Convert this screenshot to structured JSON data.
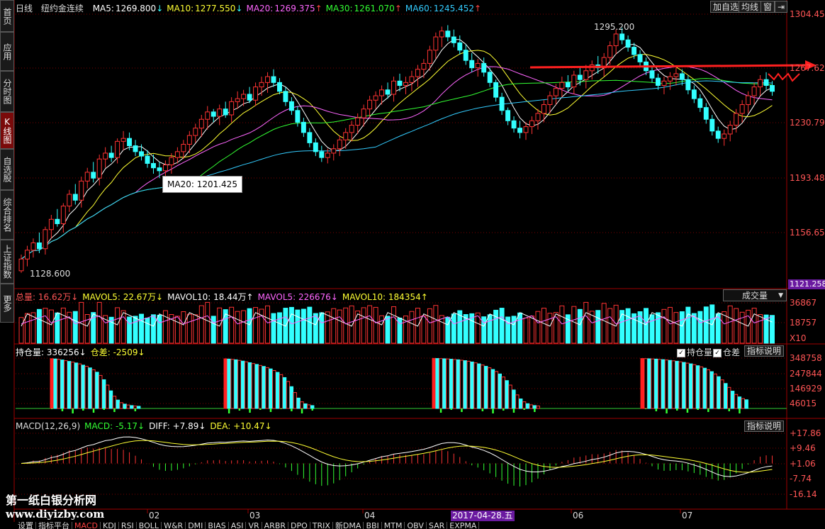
{
  "sidebar": {
    "items": [
      {
        "label": "首页",
        "active": false
      },
      {
        "label": "应用",
        "active": false
      },
      {
        "label": "分时图",
        "active": false
      },
      {
        "label": "K线图",
        "active": true
      },
      {
        "label": "自选股",
        "active": false
      },
      {
        "label": "综合排名",
        "active": false
      },
      {
        "label": "上证指数",
        "active": false
      },
      {
        "label": "更多",
        "active": false
      }
    ]
  },
  "toolbar": {
    "add_watch": "加自选",
    "ma_line": "均线",
    "window": "窗"
  },
  "header": {
    "period": "日线",
    "instrument": "纽约金连续",
    "ma": [
      {
        "label": "MA5:",
        "value": "1269.800",
        "arrow": "↓",
        "color": "#ffffff"
      },
      {
        "label": "MA10:",
        "value": "1277.550",
        "arrow": "↓",
        "color": "#ffff33"
      },
      {
        "label": "MA20:",
        "value": "1269.375",
        "arrow": "↑",
        "color": "#ff66ff"
      },
      {
        "label": "MA30:",
        "value": "1261.070",
        "arrow": "↑",
        "color": "#33ff33"
      },
      {
        "label": "MA60:",
        "value": "1245.452",
        "arrow": "↑",
        "color": "#33ccff"
      }
    ]
  },
  "price_panel": {
    "high_label": "1295.200",
    "low_label": "1128.600",
    "tooltip": "MA20: 1201.425",
    "y_ticks": [
      "1304.456",
      "1267.625",
      "1230.794",
      "1193.485",
      "1156.654",
      "1121.258"
    ],
    "current_price": "1121.258"
  },
  "volume_panel": {
    "header": [
      {
        "text": "总量: 16.62万↓",
        "color": "#ff5555"
      },
      {
        "text": "MAVOL5: 22.67万↓",
        "color": "#ffff33"
      },
      {
        "text": "MAVOL10: 18.44万↑",
        "color": "#ffffff"
      },
      {
        "text": "MAVOL5: 226676↓",
        "color": "#ff66ff"
      },
      {
        "text": "MAVOL10: 184354↑",
        "color": "#ffff33"
      }
    ],
    "dropdown": "成交量",
    "y_ticks": [
      "36867",
      "18757",
      "X10"
    ]
  },
  "oi_panel": {
    "header": [
      {
        "text": "持仓量: 336256↓",
        "color": "#ffffff"
      },
      {
        "text": "仓差: -2509↓",
        "color": "#ffff33"
      }
    ],
    "chk_oi": "持仓量",
    "chk_diff": "仓差",
    "explain": "指标说明",
    "y_ticks": [
      "348758",
      "247844",
      "146929",
      "46015"
    ]
  },
  "macd_panel": {
    "header": [
      {
        "text": "MACD(12,26,9)",
        "color": "#dddddd"
      },
      {
        "text": "MACD: -5.17↓",
        "color": "#33ff33"
      },
      {
        "text": "DIFF: +7.89↓",
        "color": "#ffffff"
      },
      {
        "text": "DEA: +10.47↓",
        "color": "#ffff33"
      }
    ],
    "explain": "指标说明",
    "y_ticks": [
      "+17.86",
      "+9.46",
      "+1.06",
      "-7.74",
      "-16.14"
    ]
  },
  "x_axis": {
    "months": [
      "02",
      "03",
      "04",
      "06",
      "07"
    ],
    "cursor_date": "2017-04-28.五"
  },
  "watermark": {
    "line1": "第一纸白银分析网",
    "line2": "www.diyizby.com"
  },
  "bottom_tabs": [
    "设置",
    "指标平台",
    "MACD",
    "KDJ",
    "RSI",
    "BOLL",
    "W&R",
    "DMI",
    "BIAS",
    "ASI",
    "VR",
    "ARBR",
    "DPO",
    "TRIX",
    "新DMA",
    "BBI",
    "MTM",
    "OBV",
    "SAR",
    "EXPMA"
  ],
  "active_bottom_tab": "MACD",
  "colors": {
    "up": "#ff3333",
    "down": "#33ffff",
    "ma5": "#ffffff",
    "ma10": "#ffff33",
    "ma20": "#ff66ff",
    "ma30": "#33ff33",
    "ma60": "#33ccff",
    "trend": "#ff2020",
    "grid": "#7a0000"
  },
  "chart_data": {
    "type": "candlestick",
    "instrument": "纽约金连续",
    "period": "日线",
    "ylim": [
      1121.258,
      1304.456
    ],
    "candles": [
      [
        1130,
        1128.6,
        1141,
        1138
      ],
      [
        1138,
        1133,
        1147,
        1144
      ],
      [
        1144,
        1139,
        1152,
        1149
      ],
      [
        1149,
        1142,
        1156,
        1145
      ],
      [
        1145,
        1141,
        1160,
        1158
      ],
      [
        1158,
        1152,
        1168,
        1165
      ],
      [
        1165,
        1160,
        1172,
        1162
      ],
      [
        1162,
        1156,
        1176,
        1174
      ],
      [
        1174,
        1170,
        1185,
        1182
      ],
      [
        1182,
        1175,
        1189,
        1178
      ],
      [
        1178,
        1173,
        1194,
        1191
      ],
      [
        1191,
        1186,
        1200,
        1197
      ],
      [
        1197,
        1190,
        1204,
        1193
      ],
      [
        1193,
        1188,
        1209,
        1206
      ],
      [
        1206,
        1200,
        1214,
        1210
      ],
      [
        1210,
        1204,
        1215,
        1207
      ],
      [
        1207,
        1203,
        1220,
        1218
      ],
      [
        1218,
        1212,
        1225,
        1220
      ],
      [
        1220,
        1212,
        1224,
        1215
      ],
      [
        1215,
        1208,
        1219,
        1211
      ],
      [
        1211,
        1205,
        1216,
        1208
      ],
      [
        1208,
        1200,
        1212,
        1203
      ],
      [
        1203,
        1196,
        1209,
        1200
      ],
      [
        1200,
        1193,
        1204,
        1198
      ],
      [
        1198,
        1192,
        1205,
        1202
      ],
      [
        1202,
        1196,
        1210,
        1207
      ],
      [
        1207,
        1203,
        1214,
        1211
      ],
      [
        1211,
        1206,
        1219,
        1216
      ],
      [
        1216,
        1210,
        1225,
        1222
      ],
      [
        1222,
        1217,
        1230,
        1227
      ],
      [
        1227,
        1221,
        1236,
        1233
      ],
      [
        1233,
        1226,
        1242,
        1238
      ],
      [
        1238,
        1231,
        1240,
        1235
      ],
      [
        1235,
        1229,
        1243,
        1240
      ],
      [
        1240,
        1234,
        1245,
        1236
      ],
      [
        1236,
        1231,
        1248,
        1245
      ],
      [
        1245,
        1240,
        1252,
        1247
      ],
      [
        1247,
        1242,
        1253,
        1250
      ],
      [
        1250,
        1244,
        1255,
        1246
      ],
      [
        1246,
        1242,
        1258,
        1255
      ],
      [
        1255,
        1249,
        1262,
        1258
      ],
      [
        1258,
        1251,
        1265,
        1262
      ],
      [
        1262,
        1255,
        1267,
        1258
      ],
      [
        1258,
        1250,
        1261,
        1252
      ],
      [
        1252,
        1242,
        1255,
        1245
      ],
      [
        1245,
        1236,
        1248,
        1239
      ],
      [
        1239,
        1228,
        1242,
        1231
      ],
      [
        1231,
        1221,
        1234,
        1224
      ],
      [
        1224,
        1214,
        1227,
        1217
      ],
      [
        1217,
        1208,
        1220,
        1211
      ],
      [
        1211,
        1204,
        1215,
        1207
      ],
      [
        1207,
        1203,
        1213,
        1210
      ],
      [
        1210,
        1205,
        1216,
        1213
      ],
      [
        1213,
        1208,
        1222,
        1219
      ],
      [
        1219,
        1213,
        1227,
        1224
      ],
      [
        1224,
        1218,
        1232,
        1229
      ],
      [
        1229,
        1223,
        1237,
        1234
      ],
      [
        1234,
        1228,
        1243,
        1240
      ],
      [
        1240,
        1234,
        1249,
        1246
      ],
      [
        1246,
        1240,
        1252,
        1249
      ],
      [
        1249,
        1243,
        1256,
        1253
      ],
      [
        1253,
        1247,
        1258,
        1250
      ],
      [
        1250,
        1245,
        1262,
        1259
      ],
      [
        1259,
        1252,
        1264,
        1256
      ],
      [
        1256,
        1250,
        1262,
        1258
      ],
      [
        1258,
        1252,
        1266,
        1262
      ],
      [
        1262,
        1255,
        1270,
        1267
      ],
      [
        1267,
        1261,
        1274,
        1271
      ],
      [
        1271,
        1266,
        1283,
        1280
      ],
      [
        1280,
        1274,
        1292,
        1289
      ],
      [
        1289,
        1282,
        1296,
        1293
      ],
      [
        1293,
        1286,
        1297,
        1289
      ],
      [
        1289,
        1282,
        1294,
        1285
      ],
      [
        1285,
        1277,
        1290,
        1280
      ],
      [
        1280,
        1270,
        1284,
        1273
      ],
      [
        1273,
        1265,
        1278,
        1268
      ],
      [
        1268,
        1262,
        1274,
        1271
      ],
      [
        1271,
        1262,
        1275,
        1265
      ],
      [
        1265,
        1255,
        1268,
        1258
      ],
      [
        1258,
        1245,
        1260,
        1248
      ],
      [
        1248,
        1236,
        1251,
        1239
      ],
      [
        1239,
        1229,
        1241,
        1232
      ],
      [
        1232,
        1224,
        1235,
        1227
      ],
      [
        1227,
        1220,
        1232,
        1224
      ],
      [
        1224,
        1219,
        1231,
        1228
      ],
      [
        1228,
        1223,
        1235,
        1232
      ],
      [
        1232,
        1226,
        1240,
        1237
      ],
      [
        1237,
        1231,
        1246,
        1243
      ],
      [
        1243,
        1237,
        1252,
        1249
      ],
      [
        1249,
        1243,
        1257,
        1254
      ],
      [
        1254,
        1248,
        1262,
        1258
      ],
      [
        1258,
        1252,
        1263,
        1255
      ],
      [
        1255,
        1250,
        1266,
        1263
      ],
      [
        1263,
        1256,
        1268,
        1260
      ],
      [
        1260,
        1254,
        1270,
        1266
      ],
      [
        1266,
        1260,
        1273,
        1270
      ],
      [
        1270,
        1264,
        1276,
        1268
      ],
      [
        1268,
        1262,
        1278,
        1275
      ],
      [
        1275,
        1270,
        1286,
        1283
      ],
      [
        1283,
        1277,
        1294,
        1291
      ],
      [
        1291,
        1284,
        1295.2,
        1287
      ],
      [
        1287,
        1279,
        1290,
        1282
      ],
      [
        1282,
        1274,
        1285,
        1277
      ],
      [
        1277,
        1269,
        1280,
        1272
      ],
      [
        1272,
        1263,
        1275,
        1266
      ],
      [
        1266,
        1258,
        1269,
        1261
      ],
      [
        1261,
        1253,
        1264,
        1256
      ],
      [
        1256,
        1250,
        1262,
        1259
      ],
      [
        1259,
        1253,
        1265,
        1262
      ],
      [
        1262,
        1256,
        1268,
        1264
      ],
      [
        1264,
        1256,
        1267,
        1260
      ],
      [
        1260,
        1250,
        1263,
        1253
      ],
      [
        1253,
        1244,
        1256,
        1247
      ],
      [
        1247,
        1238,
        1250,
        1241
      ],
      [
        1241,
        1230,
        1244,
        1233
      ],
      [
        1233,
        1222,
        1236,
        1225
      ],
      [
        1225,
        1217,
        1228,
        1220
      ],
      [
        1220,
        1215,
        1226,
        1223
      ],
      [
        1223,
        1218,
        1232,
        1229
      ],
      [
        1229,
        1224,
        1240,
        1237
      ],
      [
        1237,
        1231,
        1246,
        1243
      ],
      [
        1243,
        1237,
        1252,
        1249
      ],
      [
        1249,
        1243,
        1258,
        1255
      ],
      [
        1255,
        1249,
        1263,
        1260
      ],
      [
        1260,
        1253,
        1265,
        1256
      ],
      [
        1256,
        1249,
        1259,
        1252
      ]
    ],
    "oi": {
      "x": [
        20,
        22,
        24,
        26,
        28,
        30,
        32,
        34,
        36,
        38,
        40,
        42,
        44,
        46,
        48,
        50,
        52,
        54,
        56,
        58,
        60,
        62,
        64,
        66,
        68,
        70,
        120,
        122,
        124,
        126,
        128,
        130,
        132,
        134,
        136,
        138,
        140,
        142,
        144,
        146,
        148,
        150,
        152,
        154,
        156,
        158,
        160,
        162,
        164,
        166,
        168,
        170,
        240,
        242,
        244,
        246,
        248,
        250,
        252,
        254,
        256,
        258,
        260,
        262,
        264,
        266,
        268,
        270,
        272,
        274,
        276,
        278,
        280,
        282,
        284,
        286,
        288,
        290,
        292,
        294,
        296,
        298,
        300,
        360,
        362,
        364,
        366,
        368,
        370,
        372,
        374,
        376,
        378,
        380,
        382,
        384,
        386,
        388,
        390,
        392,
        394,
        396,
        398,
        400,
        402,
        404,
        406,
        408,
        410,
        412,
        414,
        416,
        418,
        420
      ],
      "values": [
        345000,
        343000,
        340000,
        336000,
        331000,
        326000,
        321000,
        315000,
        309000,
        300000,
        292000,
        281000,
        268000,
        251000,
        229000,
        199000,
        162000,
        122000,
        85000,
        58000,
        40000,
        30000,
        24000,
        20000,
        17000,
        15000,
        344000,
        342000,
        340000,
        337000,
        333000,
        328000,
        323000,
        317000,
        311000,
        305000,
        298000,
        291000,
        283000,
        274000,
        263000,
        250000,
        234000,
        214000,
        187000,
        151000,
        110000,
        72000,
        46000,
        32000,
        25000,
        20000,
        347000,
        346000,
        345000,
        344000,
        343000,
        341000,
        339000,
        337000,
        334000,
        331000,
        327000,
        322000,
        316000,
        309000,
        301000,
        292000,
        282000,
        270000,
        256000,
        239000,
        218000,
        193000,
        162000,
        128000,
        94000,
        66000,
        46000,
        33000,
        25000,
        20000,
        17000,
        346000,
        345000,
        344000,
        343000,
        342000,
        340000,
        338000,
        336000,
        333000,
        330000,
        327000,
        323000,
        319000,
        314000,
        309000,
        303000,
        296000,
        288000,
        279000,
        268000,
        255000,
        239000,
        220000,
        198000,
        173000,
        146000,
        120000,
        97000,
        80000,
        68000,
        60000
      ]
    },
    "volume": {
      "ylim": [
        0,
        368670
      ]
    },
    "macd": {
      "ylim": [
        -16.14,
        17.86
      ],
      "diff": 7.89,
      "dea": 10.47,
      "macd": -5.17
    }
  }
}
